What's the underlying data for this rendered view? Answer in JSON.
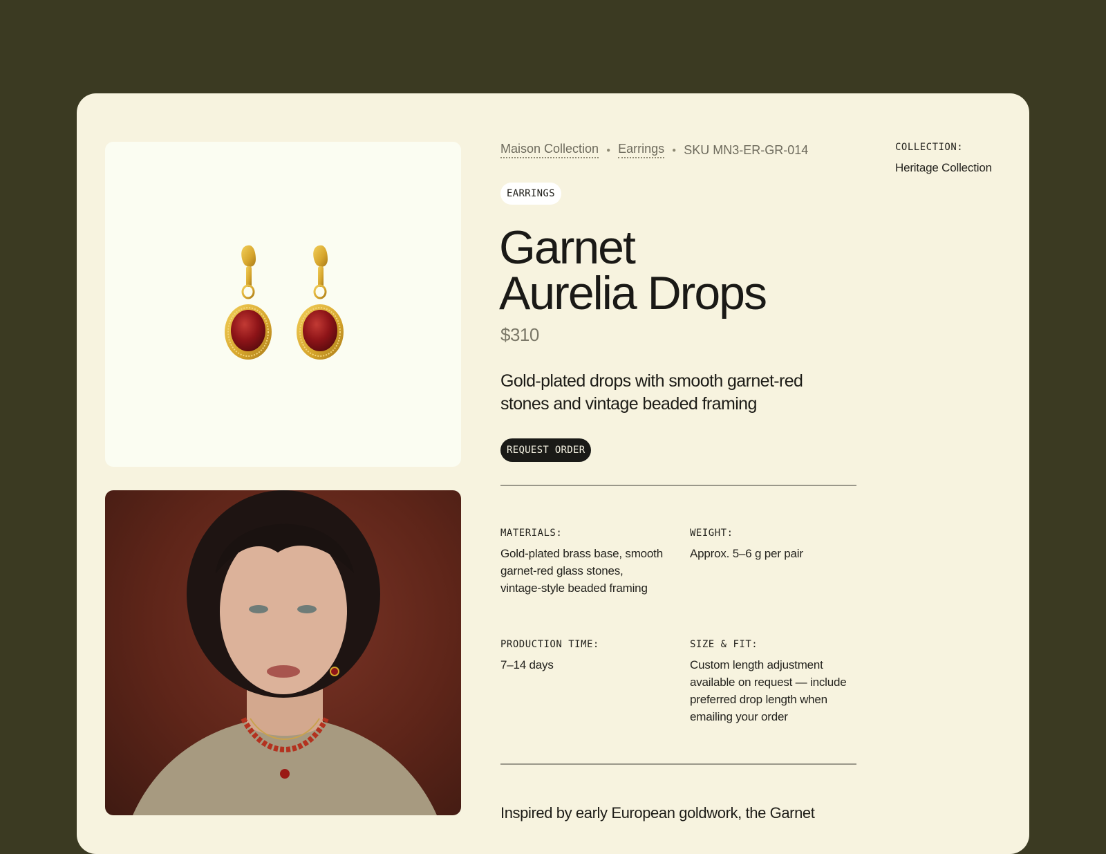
{
  "breadcrumb": {
    "collection": "Maison Collection",
    "category": "Earrings",
    "sku": "SKU MN3-ER-GR-014"
  },
  "product": {
    "tag": "EARRINGS",
    "title_line1": "Garnet",
    "title_line2": "Aurelia Drops",
    "price": "$310",
    "tagline": "Gold-plated drops with smooth garnet-red stones and vintage beaded framing",
    "cta_label": "REQUEST ORDER"
  },
  "specs": {
    "materials": {
      "label": "MATERIALS:",
      "value": "Gold-plated brass base, smooth garnet-red glass stones, vintage-style beaded framing"
    },
    "weight": {
      "label": "WEIGHT:",
      "value": "Approx. 5–6 g per pair"
    },
    "production_time": {
      "label": "PRODUCTION TIME:",
      "value": "7–14 days"
    },
    "size_fit": {
      "label": "SIZE & FIT:",
      "value": "Custom length adjustment available on request — include preferred drop length when emailing your order"
    }
  },
  "collection": {
    "label": "COLLECTION:",
    "value": "Heritage Collection"
  },
  "intro_text": "Inspired by early European goldwork, the Garnet",
  "colors": {
    "page_background": "#3b3a22",
    "card_background": "#f7f3df",
    "cta_background": "#1a1a17",
    "garnet": "#8e1418",
    "gold": "#d6a52c"
  },
  "icons": [
    "earring-product-photo",
    "model-portrait-photo"
  ]
}
